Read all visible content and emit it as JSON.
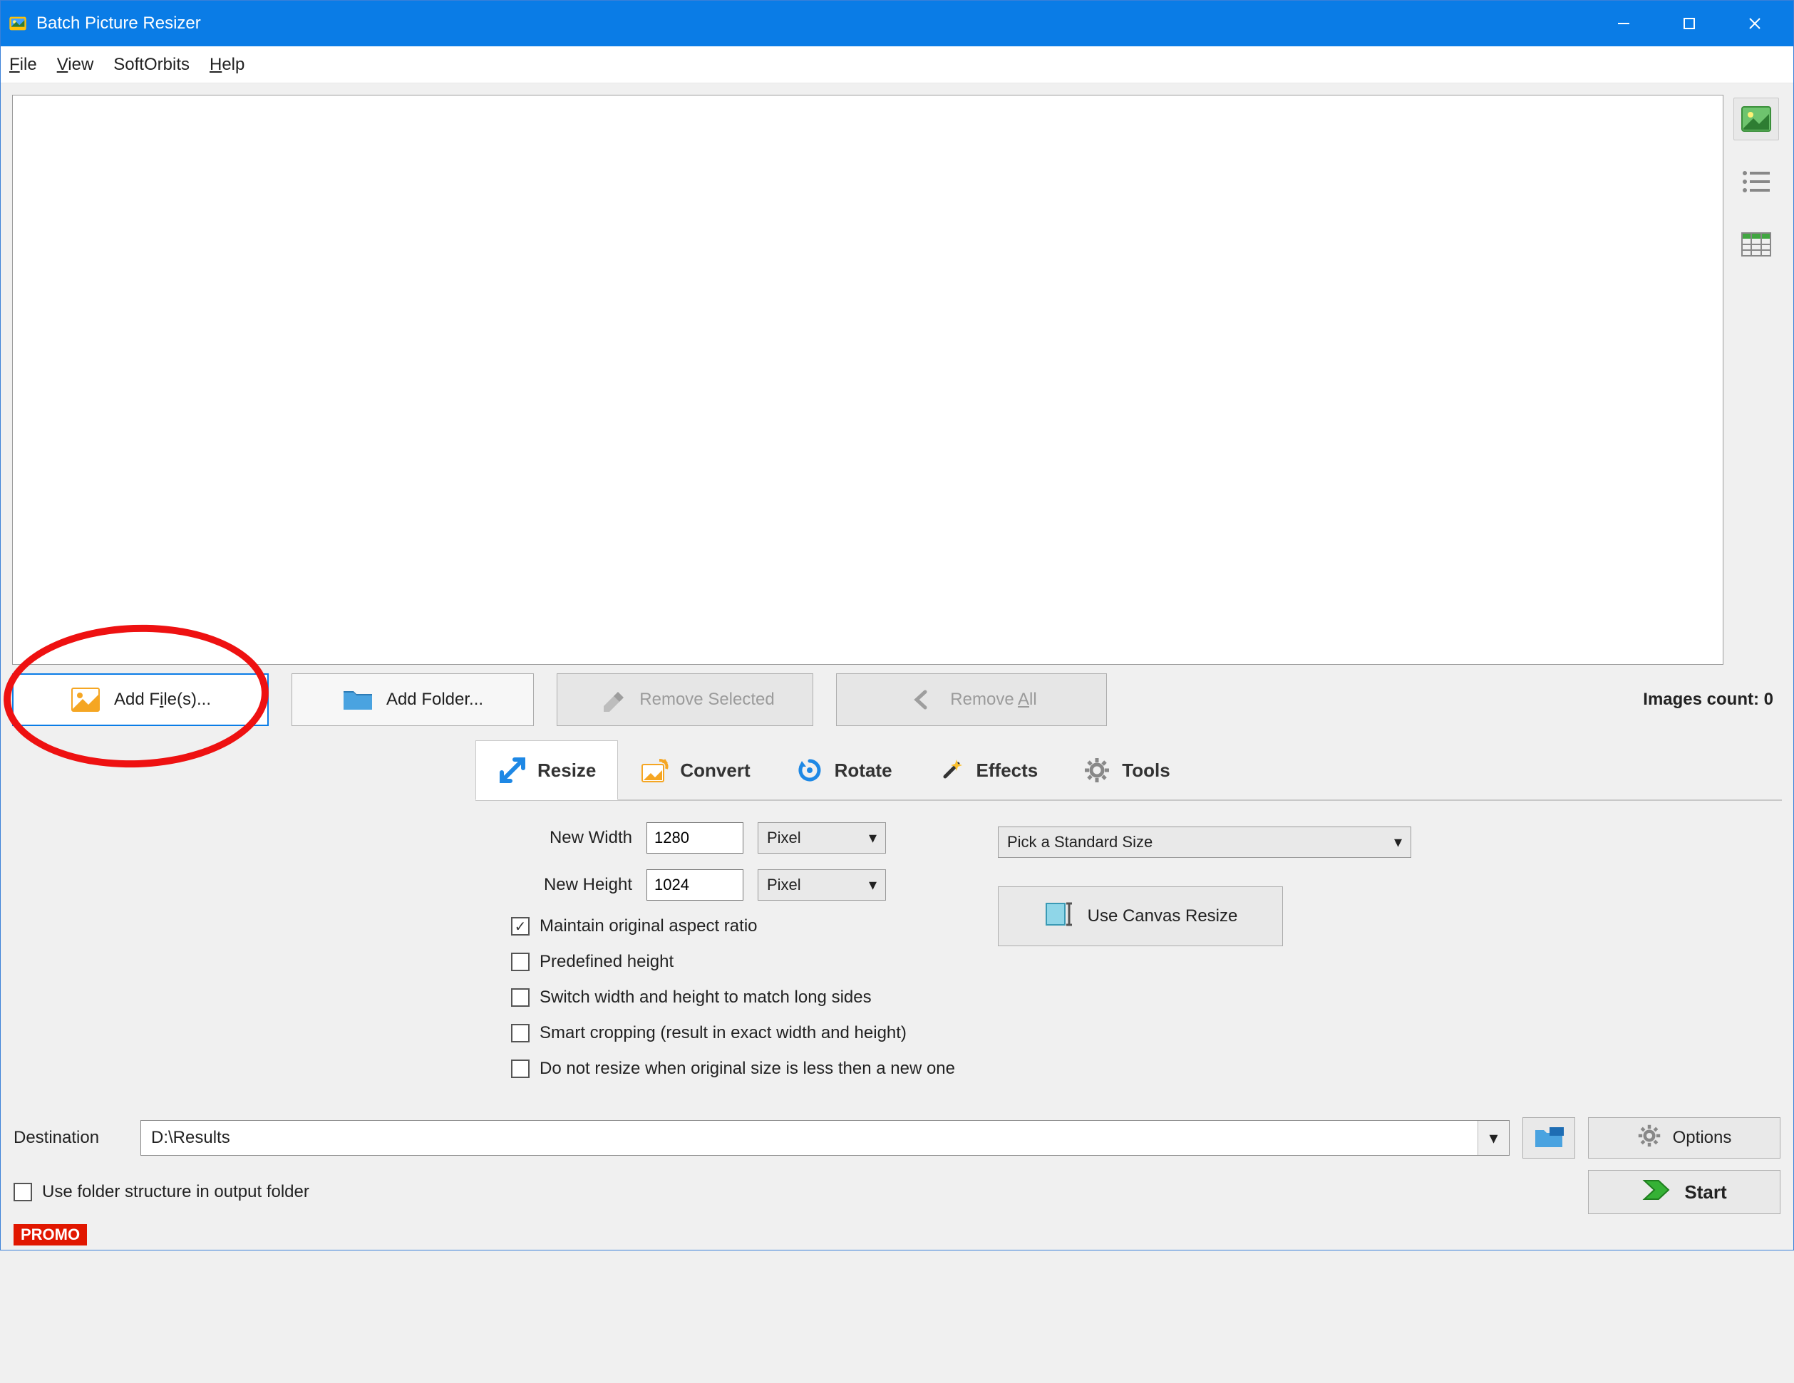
{
  "window": {
    "title": "Batch Picture Resizer"
  },
  "menubar": {
    "file": {
      "u": "F",
      "rest": "ile"
    },
    "view": {
      "u": "V",
      "rest": "iew"
    },
    "softorbits": {
      "label": "SoftOrbits"
    },
    "help": {
      "u": "H",
      "rest": "elp"
    }
  },
  "toolbar": {
    "add_files": {
      "pre": "Add F",
      "u": "i",
      "post": "le(s)..."
    },
    "add_folder": {
      "label": "Add Folder..."
    },
    "remove_selected": {
      "label": "Remove Selected"
    },
    "remove_all": {
      "pre": "Remove ",
      "u": "A",
      "post": "ll"
    }
  },
  "status": {
    "images_count_label": "Images count: ",
    "images_count_value": "0"
  },
  "tabs": {
    "resize": "Resize",
    "convert": "Convert",
    "rotate": "Rotate",
    "effects": "Effects",
    "tools": "Tools"
  },
  "resize_panel": {
    "new_width_label": "New Width",
    "new_width_value": "1280",
    "new_height_label": "New Height",
    "new_height_value": "1024",
    "unit_width": "Pixel",
    "unit_height": "Pixel",
    "standard_size": "Pick a Standard Size",
    "canvas_resize": "Use Canvas Resize",
    "chk_aspect": {
      "label": "Maintain original aspect ratio",
      "checked": true
    },
    "chk_predefined": {
      "label": "Predefined height",
      "checked": false
    },
    "chk_switch": {
      "label": "Switch width and height to match long sides",
      "checked": false
    },
    "chk_smart": {
      "label": "Smart cropping (result in exact width and height)",
      "checked": false
    },
    "chk_noresize": {
      "label": "Do not resize when original size is less then a new one",
      "checked": false
    }
  },
  "destination": {
    "label": "Destination",
    "value": "D:\\Results",
    "options_label": "Options",
    "use_folder_structure": {
      "label": "Use folder structure in output folder",
      "checked": false
    }
  },
  "start_label": "Start",
  "promo_label": "PROMO"
}
